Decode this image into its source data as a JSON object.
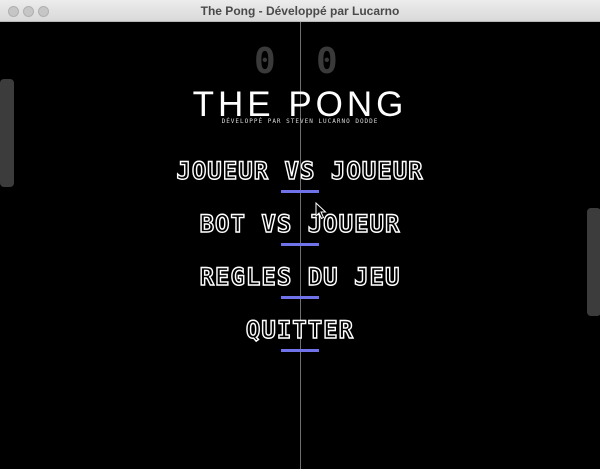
{
  "window": {
    "title": "The Pong - Développé par Lucarno"
  },
  "scoreboard": {
    "left": "0",
    "right": "0"
  },
  "header": {
    "logo": "THE PONG",
    "subtitle": "DÉVELOPPÉ PAR STEVEN LUCARNO DODDE"
  },
  "menu": {
    "items": [
      {
        "label": "JOUEUR VS JOUEUR"
      },
      {
        "label": "BOT VS JOUEUR"
      },
      {
        "label": "REGLES DU JEU"
      },
      {
        "label": "QUITTER"
      }
    ]
  },
  "colors": {
    "background": "#000000",
    "text": "#ffffff",
    "accent_underline": "#6f72e8",
    "center_line": "#6e6e6e"
  }
}
